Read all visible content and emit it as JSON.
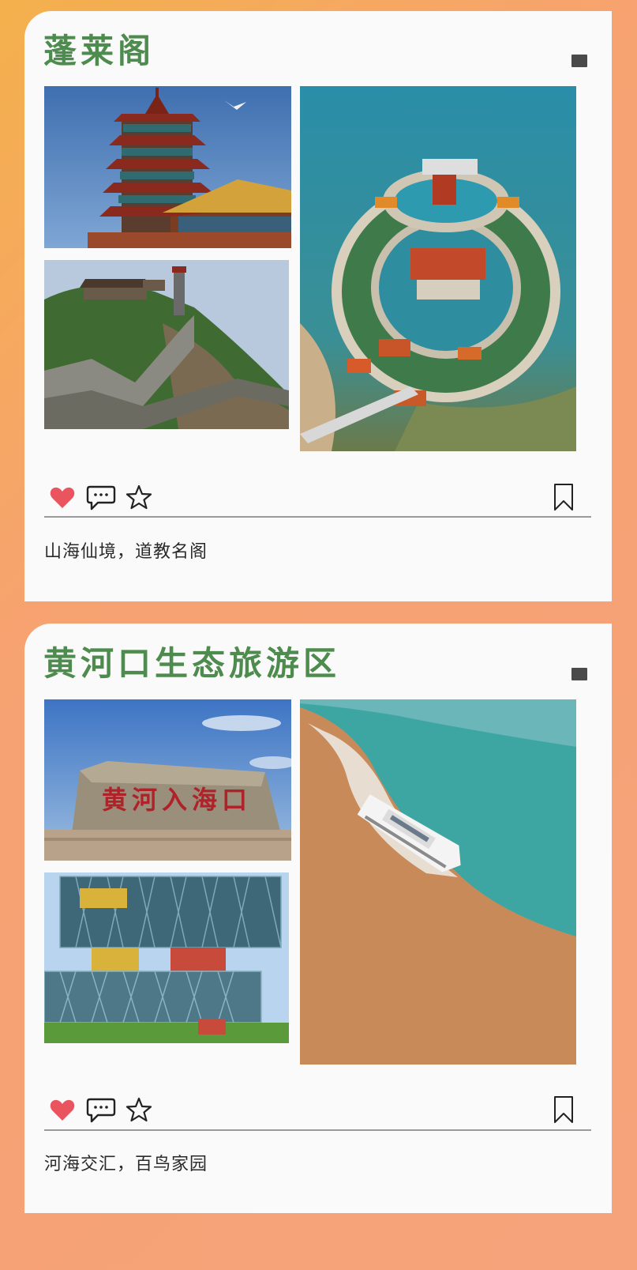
{
  "posts": [
    {
      "title": "蓬莱阁",
      "caption": "山海仙境，道教名阁",
      "photos": [
        "pavilion-tower-photo",
        "great-wall-hill-photo",
        "island-temple-aerial-photo"
      ]
    },
    {
      "title": "黄河口生态旅游区",
      "caption": "河海交汇，百鸟家园",
      "stone_inscription": "黄河入海口",
      "photos": [
        "yellow-river-stone-photo",
        "museum-building-photo",
        "ferry-boat-estuary-photo"
      ]
    }
  ],
  "actions": [
    "like-heart-icon",
    "comment-icon",
    "star-icon",
    "bookmark-icon"
  ],
  "colors": {
    "title_green": "#4e8b4e",
    "heart_red": "#e9545f",
    "card_bg": "#fafafa",
    "bg_start": "#f4b04c",
    "bg_end": "#f6a37c"
  }
}
